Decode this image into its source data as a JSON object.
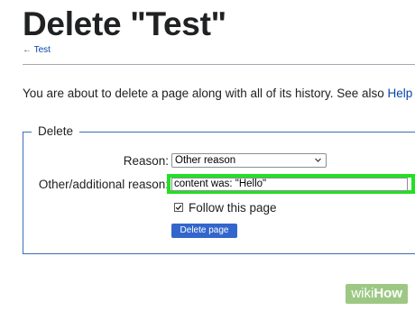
{
  "page": {
    "title": "Delete \"Test\"",
    "back_arrow": "←",
    "back_link": "Test",
    "intro_text": "You are about to delete a page along with all of its history. See also ",
    "intro_link": "Help"
  },
  "form": {
    "legend": "Delete",
    "reason_label": "Reason:",
    "reason_selected": "Other reason",
    "other_label": "Other/additional reason:",
    "other_value": "content was: \"Hello\"",
    "follow_label": "Follow this page",
    "follow_checked": true,
    "delete_button": "Delete page"
  },
  "colors": {
    "link": "#0645ad",
    "button": "#3366cc",
    "highlight": "#22e022",
    "fieldset_border": "#3a6fb0"
  },
  "watermark": {
    "part1": "wiki",
    "part2": "How"
  }
}
